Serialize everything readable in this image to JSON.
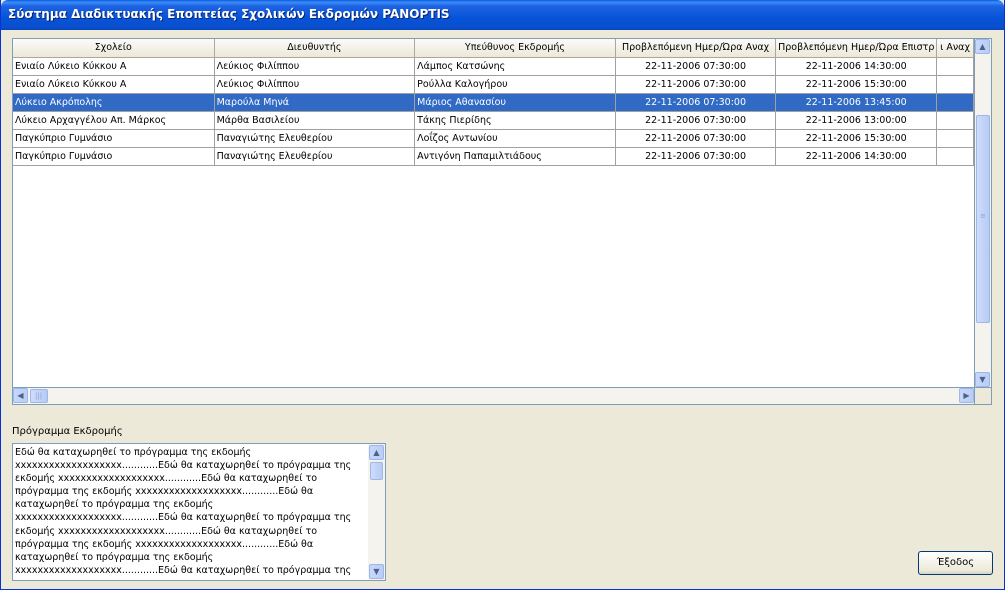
{
  "window": {
    "title": "Σύστημα Διαδικτυακής Εποπτείας Σχολικών Εκδρομών PANOPTIS"
  },
  "grid": {
    "columns": [
      "Σχολείο",
      "Διευθυντής",
      "Υπεύθυνος Εκδρομής",
      "Προβλεπόμενη Ημερ/Ώρα Αναχ",
      "Προβλεπόμενη Ημερ/Ώρα Επιστρ",
      "ι Αναχ"
    ],
    "rows": [
      [
        "Ενιαίο Λύκειο Κύκκου Α",
        "Λεύκιος Φιλίππου",
        "Λάμπος Κατσώνης",
        "22-11-2006 07:30:00",
        "22-11-2006 14:30:00",
        ""
      ],
      [
        "Ενιαίο Λύκειο Κύκκου Α",
        "Λεύκιος Φιλίππου",
        "Ρούλλα Καλογήρου",
        "22-11-2006 07:30:00",
        "22-11-2006 15:30:00",
        ""
      ],
      [
        "Λύκειο Ακρόπολης",
        "Μαρούλα Μηνά",
        "Μάριος Αθανασίου",
        "22-11-2006 07:30:00",
        "22-11-2006 13:45:00",
        ""
      ],
      [
        "Λύκειο Αρχαγγέλου Απ. Μάρκος",
        "Μάρθα Βασιλείου",
        "Τάκης Πιερίδης",
        "22-11-2006 07:30:00",
        "22-11-2006 13:00:00",
        ""
      ],
      [
        "Παγκύπριο Γυμνάσιο",
        "Παναγιώτης Ελευθερίου",
        "Λοΐζος Αντωνίου",
        "22-11-2006 07:30:00",
        "22-11-2006 15:30:00",
        ""
      ],
      [
        "Παγκύπριο Γυμνάσιο",
        "Παναγιώτης Ελευθερίου",
        "Αντιγόνη Παπαμιλτιάδους",
        "22-11-2006 07:30:00",
        "22-11-2006 14:30:00",
        ""
      ]
    ],
    "selected_row": 2
  },
  "program": {
    "label": "Πρόγραμμα Εκδρομής",
    "lines": [
      "Εδώ θα καταχωρηθεί το πρόγραμμα της εκδομής",
      "xxxxxxxxxxxxxxxxxxx............Εδώ θα καταχωρηθεί το πρόγραμμα της",
      "εκδομής xxxxxxxxxxxxxxxxxxx............Εδώ θα καταχωρηθεί το",
      "πρόγραμμα της εκδομής xxxxxxxxxxxxxxxxxxx............Εδώ θα",
      "καταχωρηθεί το πρόγραμμα της εκδομής",
      "xxxxxxxxxxxxxxxxxxx............Εδώ θα καταχωρηθεί το πρόγραμμα της",
      "εκδομής xxxxxxxxxxxxxxxxxxx............Εδώ θα καταχωρηθεί το",
      "πρόγραμμα της εκδομής xxxxxxxxxxxxxxxxxxx............Εδώ θα",
      "καταχωρηθεί το πρόγραμμα της εκδομής",
      "xxxxxxxxxxxxxxxxxxx............Εδώ θα καταχωρηθεί το πρόγραμμα της"
    ]
  },
  "buttons": {
    "exit": "Έξοδος"
  },
  "icons": {
    "scroll_up": "arrow-up-icon",
    "scroll_down": "arrow-down-icon",
    "scroll_left": "arrow-left-icon",
    "scroll_right": "arrow-right-icon"
  },
  "colors": {
    "titlebar": "#0653d8",
    "selection": "#316ac5",
    "background": "#ece9d8"
  }
}
